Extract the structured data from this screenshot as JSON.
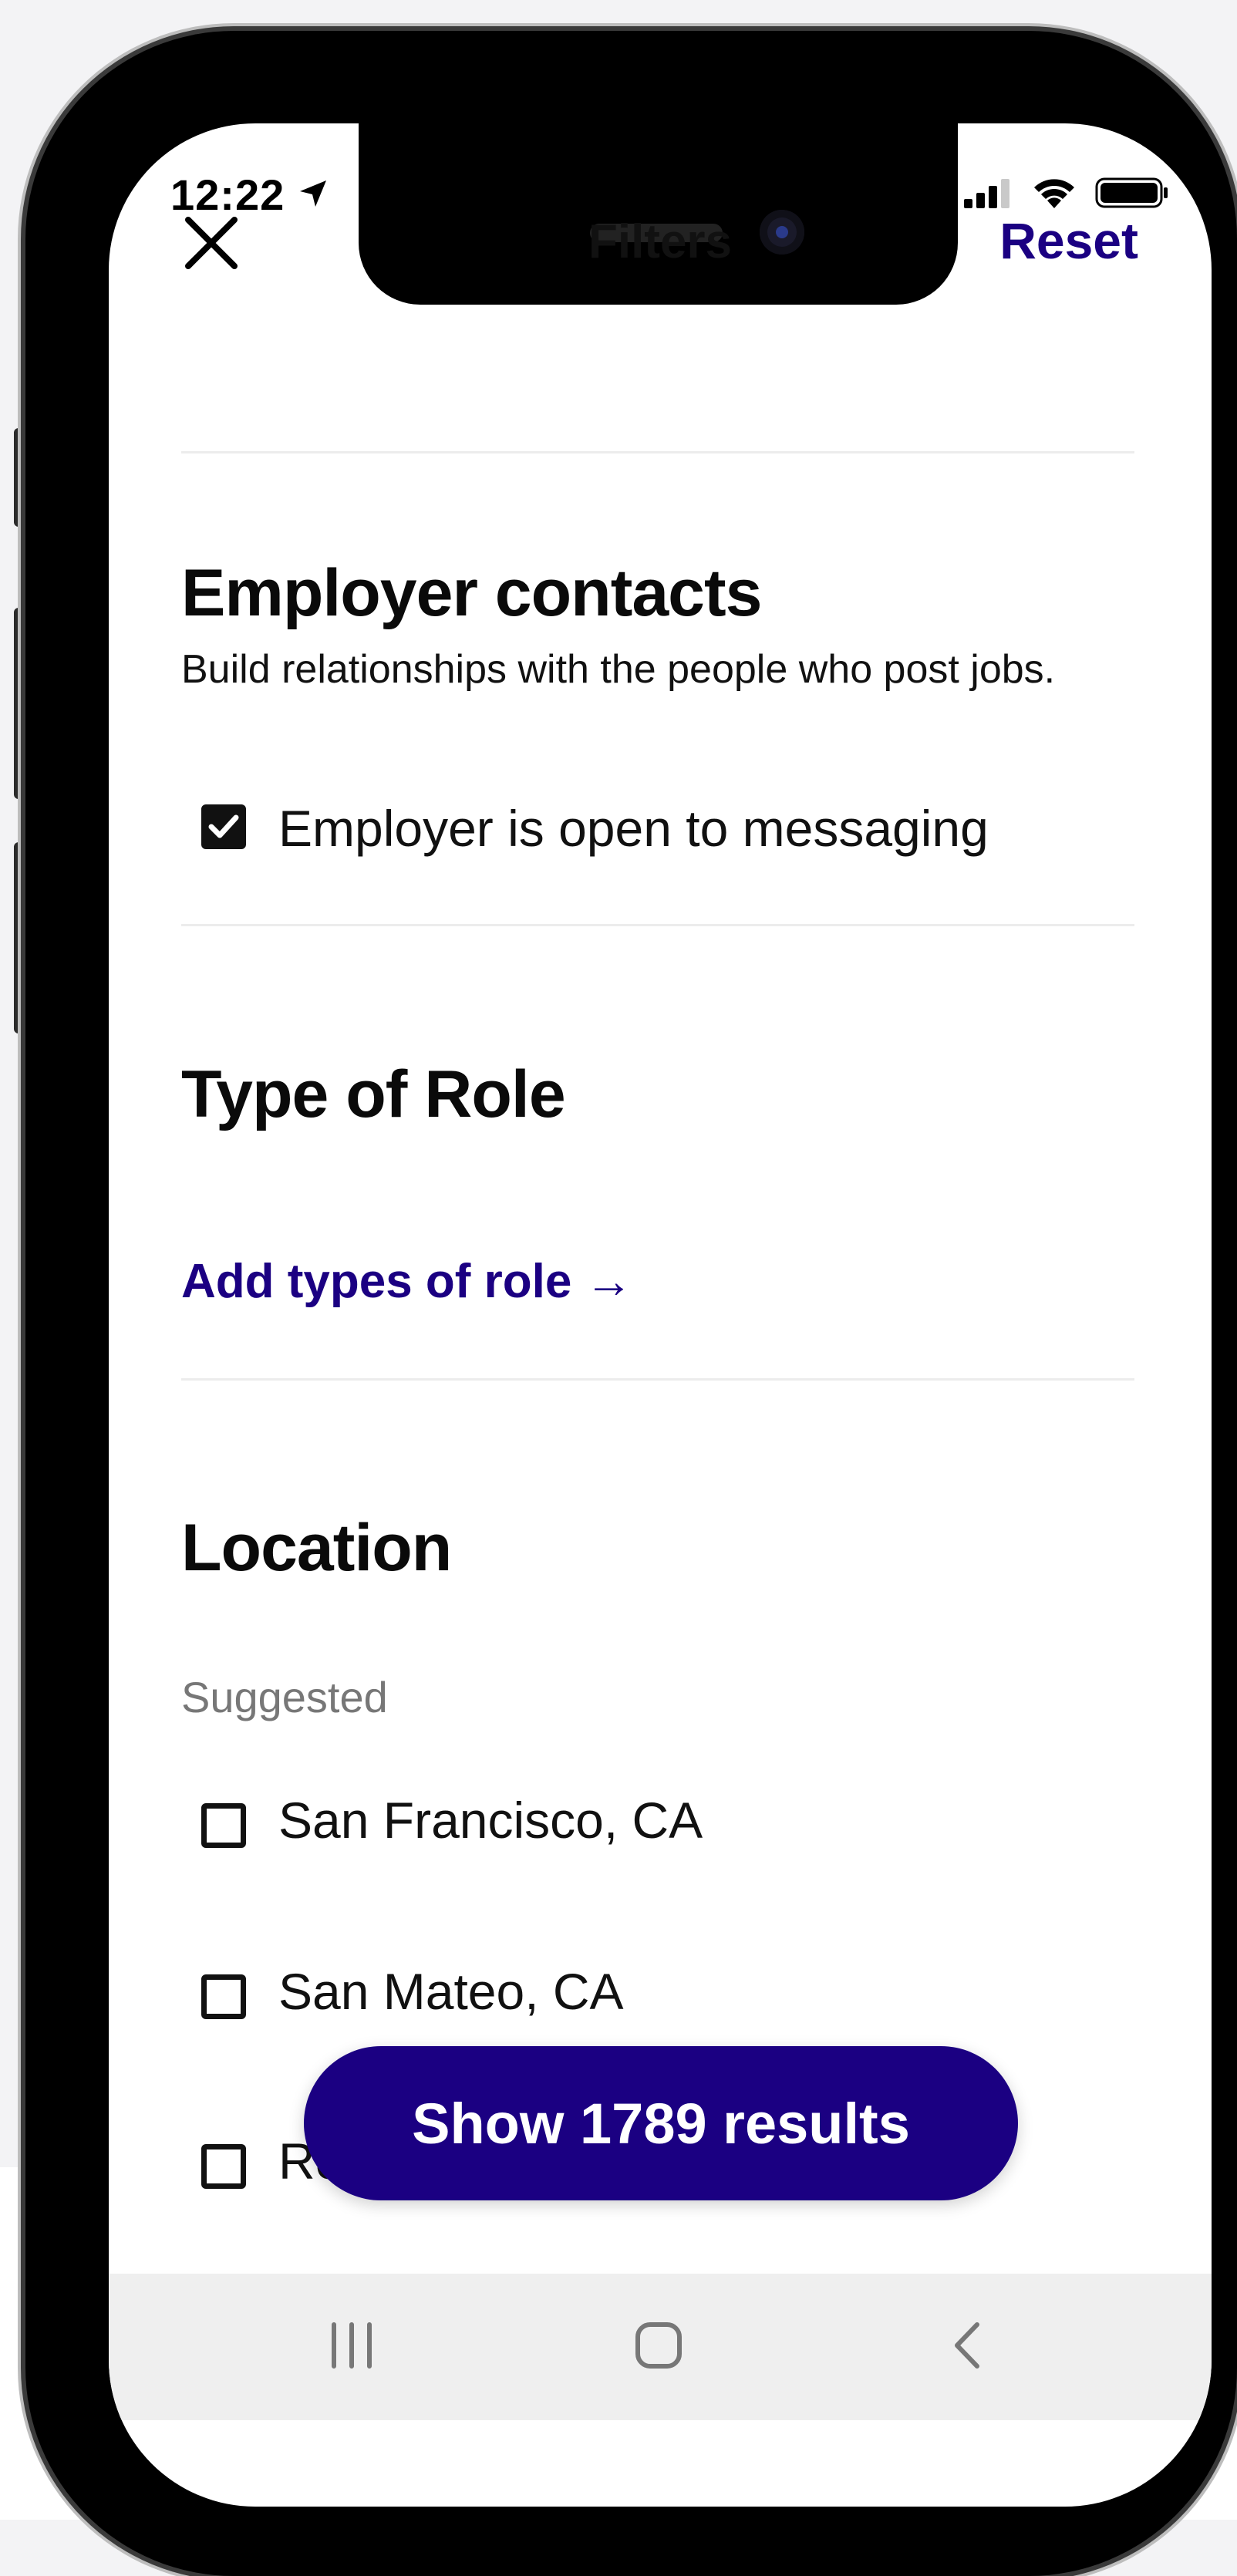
{
  "status_bar": {
    "time": "12:22",
    "icons": [
      "location-arrow-icon",
      "signal-icon",
      "wifi-icon",
      "battery-icon"
    ]
  },
  "header": {
    "title": "Filters",
    "reset_label": "Reset",
    "close_icon": "close-icon"
  },
  "employer_contacts": {
    "title": "Employer contacts",
    "description": "Build relationships with the people who post jobs.",
    "option": {
      "label": "Employer is open to messaging",
      "checked": true
    }
  },
  "type_of_role": {
    "title": "Type of Role",
    "link_label": "Add types of role →"
  },
  "location": {
    "title": "Location",
    "subheading": "Suggested",
    "options": [
      {
        "label": "San Francisco, CA",
        "checked": false
      },
      {
        "label": "San Mateo, CA",
        "checked": false
      },
      {
        "label": "Re",
        "checked": false
      }
    ]
  },
  "cta": {
    "label": "Show 1789 results"
  },
  "nav_bar": {
    "items": [
      "recent-apps-icon",
      "home-icon",
      "back-icon"
    ]
  },
  "colors": {
    "brand": "#1b0082",
    "text": "#111111",
    "muted": "#777777",
    "divider": "#ececec",
    "nav_bg": "#efefef"
  }
}
